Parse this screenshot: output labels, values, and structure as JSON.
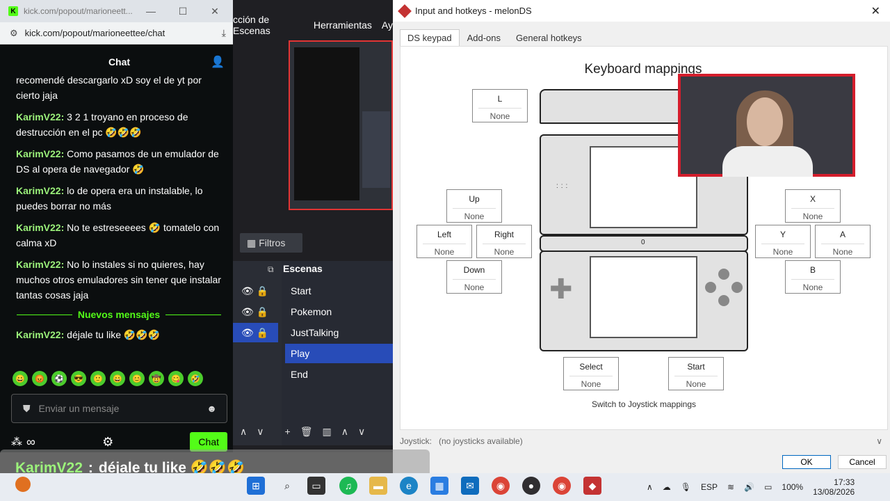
{
  "browser": {
    "tab_title": "kick.com/popout/marioneett...",
    "url": "kick.com/popout/marioneettee/chat",
    "minimize": "—",
    "maximize": "☐",
    "close": "✕"
  },
  "chat": {
    "header": "Chat",
    "messages": [
      {
        "user": "",
        "text": "recomendé descargarlo xD soy el de yt por cierto jaja"
      },
      {
        "user": "KarimV22:",
        "text": "3 2 1 troyano en proceso de destrucción en el pc 🤣🤣🤣"
      },
      {
        "user": "KarimV22:",
        "text": "Como pasamos de un emulador de DS al opera de navegador 🤣"
      },
      {
        "user": "KarimV22:",
        "text": "lo de opera era un instalable, lo puedes borrar no más"
      },
      {
        "user": "KarimV22:",
        "text": "No te estreseeees 🤣 tomatelo con calma xD"
      },
      {
        "user": "KarimV22:",
        "text": "No lo instales si no quieres, hay muchos otros emuladores sin tener que instalar tantas cosas jaja"
      }
    ],
    "new_messages": "Nuevos mensajes",
    "latest": {
      "user": "KarimV22:",
      "text": "déjale tu like 🤣🤣🤣"
    },
    "input_placeholder": "Enviar un mensaje",
    "send_label": "Chat",
    "infinity": "∞"
  },
  "obs": {
    "menu": [
      "cción de Escenas",
      "Herramientas",
      "Ay"
    ],
    "filters_label": "Filtros",
    "scenes_header": "Escenas",
    "scenes": [
      "Start",
      "Pokemon",
      "JustTalking",
      "Play",
      "End"
    ],
    "active_scene": "Play"
  },
  "melon": {
    "title": "Input and hotkeys - melonDS",
    "tabs": [
      "DS keypad",
      "Add-ons",
      "General hotkeys"
    ],
    "heading": "Keyboard mappings",
    "keys": {
      "L": "None",
      "Up": "None",
      "Left": "None",
      "Right": "None",
      "Down": "None",
      "X": "None",
      "Y": "None",
      "A": "None",
      "B": "None",
      "Select": "None",
      "Start": "None"
    },
    "key_labels": {
      "L": "L",
      "Up": "Up",
      "Left": "Left",
      "Right": "Right",
      "Down": "Down",
      "X": "X",
      "Y": "Y",
      "A": "A",
      "B": "B",
      "Select": "Select",
      "Start": "Start"
    },
    "hinge_label": "0",
    "switch_link": "Switch to Joystick mappings",
    "joystick_label": "Joystick:",
    "joystick_value": "(no joysticks available)",
    "ok": "OK",
    "cancel": "Cancel"
  },
  "overlay": {
    "user": "KarimV22",
    "sep": ":",
    "text": "déjale tu like 🤣🤣🤣"
  },
  "taskbar": {
    "lang": "ESP",
    "battery": "100%",
    "time": "17:33",
    "date": "13/08/2026"
  }
}
